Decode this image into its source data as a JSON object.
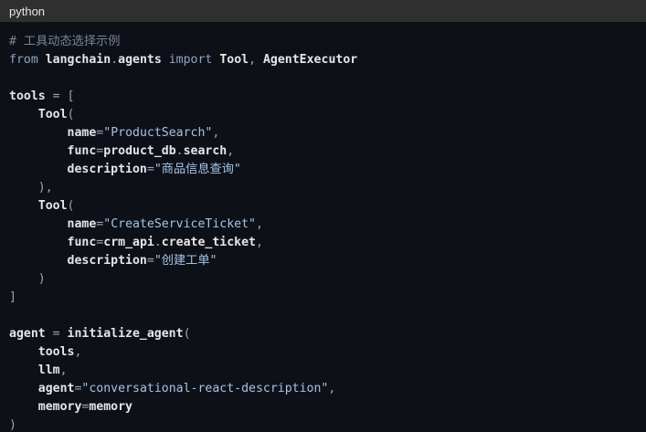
{
  "header": {
    "language": "python"
  },
  "code": {
    "lines": [
      [
        {
          "t": "comment",
          "v": "# 工具动态选择示例"
        }
      ],
      [
        {
          "t": "keyword",
          "v": "from"
        },
        {
          "t": "plain",
          "v": " "
        },
        {
          "t": "ident",
          "v": "langchain"
        },
        {
          "t": "op",
          "v": "."
        },
        {
          "t": "ident",
          "v": "agents"
        },
        {
          "t": "plain",
          "v": " "
        },
        {
          "t": "keyword",
          "v": "import"
        },
        {
          "t": "plain",
          "v": " "
        },
        {
          "t": "ident",
          "v": "Tool"
        },
        {
          "t": "op",
          "v": ", "
        },
        {
          "t": "ident",
          "v": "AgentExecutor"
        }
      ],
      [],
      [
        {
          "t": "ident",
          "v": "tools"
        },
        {
          "t": "op",
          "v": " = ["
        }
      ],
      [
        {
          "t": "plain",
          "v": "    "
        },
        {
          "t": "ident",
          "v": "Tool"
        },
        {
          "t": "op",
          "v": "("
        }
      ],
      [
        {
          "t": "plain",
          "v": "        "
        },
        {
          "t": "ident",
          "v": "name"
        },
        {
          "t": "op",
          "v": "="
        },
        {
          "t": "string",
          "v": "\"ProductSearch\""
        },
        {
          "t": "op",
          "v": ","
        }
      ],
      [
        {
          "t": "plain",
          "v": "        "
        },
        {
          "t": "ident",
          "v": "func"
        },
        {
          "t": "op",
          "v": "="
        },
        {
          "t": "ident",
          "v": "product_db"
        },
        {
          "t": "op",
          "v": "."
        },
        {
          "t": "ident",
          "v": "search"
        },
        {
          "t": "op",
          "v": ","
        }
      ],
      [
        {
          "t": "plain",
          "v": "        "
        },
        {
          "t": "ident",
          "v": "description"
        },
        {
          "t": "op",
          "v": "="
        },
        {
          "t": "string",
          "v": "\"商品信息查询\""
        }
      ],
      [
        {
          "t": "plain",
          "v": "    "
        },
        {
          "t": "op",
          "v": "),"
        }
      ],
      [
        {
          "t": "plain",
          "v": "    "
        },
        {
          "t": "ident",
          "v": "Tool"
        },
        {
          "t": "op",
          "v": "("
        }
      ],
      [
        {
          "t": "plain",
          "v": "        "
        },
        {
          "t": "ident",
          "v": "name"
        },
        {
          "t": "op",
          "v": "="
        },
        {
          "t": "string",
          "v": "\"CreateServiceTicket\""
        },
        {
          "t": "op",
          "v": ","
        }
      ],
      [
        {
          "t": "plain",
          "v": "        "
        },
        {
          "t": "ident",
          "v": "func"
        },
        {
          "t": "op",
          "v": "="
        },
        {
          "t": "ident",
          "v": "crm_api"
        },
        {
          "t": "op",
          "v": "."
        },
        {
          "t": "ident",
          "v": "create_ticket"
        },
        {
          "t": "op",
          "v": ","
        }
      ],
      [
        {
          "t": "plain",
          "v": "        "
        },
        {
          "t": "ident",
          "v": "description"
        },
        {
          "t": "op",
          "v": "="
        },
        {
          "t": "string",
          "v": "\"创建工单\""
        }
      ],
      [
        {
          "t": "plain",
          "v": "    "
        },
        {
          "t": "op",
          "v": ")"
        }
      ],
      [
        {
          "t": "op",
          "v": "]"
        }
      ],
      [],
      [
        {
          "t": "ident",
          "v": "agent"
        },
        {
          "t": "op",
          "v": " = "
        },
        {
          "t": "ident",
          "v": "initialize_agent"
        },
        {
          "t": "op",
          "v": "("
        }
      ],
      [
        {
          "t": "plain",
          "v": "    "
        },
        {
          "t": "ident",
          "v": "tools"
        },
        {
          "t": "op",
          "v": ","
        }
      ],
      [
        {
          "t": "plain",
          "v": "    "
        },
        {
          "t": "ident",
          "v": "llm"
        },
        {
          "t": "op",
          "v": ","
        }
      ],
      [
        {
          "t": "plain",
          "v": "    "
        },
        {
          "t": "ident",
          "v": "agent"
        },
        {
          "t": "op",
          "v": "="
        },
        {
          "t": "string",
          "v": "\"conversational-react-description\""
        },
        {
          "t": "op",
          "v": ","
        }
      ],
      [
        {
          "t": "plain",
          "v": "    "
        },
        {
          "t": "ident",
          "v": "memory"
        },
        {
          "t": "op",
          "v": "="
        },
        {
          "t": "ident",
          "v": "memory"
        }
      ],
      [
        {
          "t": "op",
          "v": ")"
        }
      ]
    ]
  },
  "colors": {
    "background": "#0d1117",
    "header_background": "#2f2f2f",
    "comment": "#7b8496",
    "keyword": "#8fa3c4",
    "string": "#a5c2e8",
    "identifier": "#e6e6e6"
  }
}
